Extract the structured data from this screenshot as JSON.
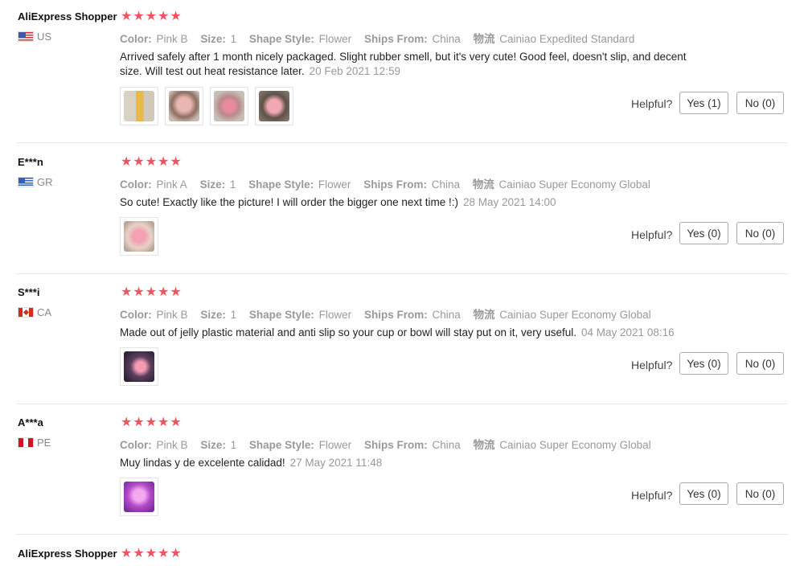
{
  "reviews": [
    {
      "user": "AliExpress Shopper",
      "country": "US",
      "stars": "★★★★★",
      "attrs": {
        "color_label": "Color:",
        "color": "Pink B",
        "size_label": "Size:",
        "size": "1",
        "shape_label": "Shape Style:",
        "shape": "Flower",
        "ships_label": "Ships From:",
        "ships": "China",
        "logistics_label": "物流",
        "logistics": "Cainiao Expedited Standard"
      },
      "text": "Arrived safely after 1 month nicely packaged. Slight rubber smell, but it's very cute! Good feel, doesn't slip, and decent size. Will test out heat resistance later.",
      "date": "20 Feb 2021 12:59",
      "helpful": "Helpful?",
      "yes": "Yes (1)",
      "no": "No (0)"
    },
    {
      "user": "E***n",
      "country": "GR",
      "stars": "★★★★★",
      "attrs": {
        "color_label": "Color:",
        "color": "Pink A",
        "size_label": "Size:",
        "size": "1",
        "shape_label": "Shape Style:",
        "shape": "Flower",
        "ships_label": "Ships From:",
        "ships": "China",
        "logistics_label": "物流",
        "logistics": "Cainiao Super Economy Global"
      },
      "text": "So cute! Exactly like the picture! I will order the bigger one next time !:)",
      "date": "28 May 2021 14:00",
      "helpful": "Helpful?",
      "yes": "Yes (0)",
      "no": "No (0)"
    },
    {
      "user": "S***i",
      "country": "CA",
      "stars": "★★★★★",
      "attrs": {
        "color_label": "Color:",
        "color": "Pink B",
        "size_label": "Size:",
        "size": "1",
        "shape_label": "Shape Style:",
        "shape": "Flower",
        "ships_label": "Ships From:",
        "ships": "China",
        "logistics_label": "物流",
        "logistics": "Cainiao Super Economy Global"
      },
      "text": "Made out of jelly plastic material and anti slip so your cup or bowl will stay put on it, very useful.",
      "date": "04 May 2021 08:16",
      "helpful": "Helpful?",
      "yes": "Yes (0)",
      "no": "No (0)"
    },
    {
      "user": "A***a",
      "country": "PE",
      "stars": "★★★★★",
      "attrs": {
        "color_label": "Color:",
        "color": "Pink B",
        "size_label": "Size:",
        "size": "1",
        "shape_label": "Shape Style:",
        "shape": "Flower",
        "ships_label": "Ships From:",
        "ships": "China",
        "logistics_label": "物流",
        "logistics": "Cainiao Super Economy Global"
      },
      "text": "Muy lindas y de excelente calidad!",
      "date": "27 May 2021 11:48",
      "helpful": "Helpful?",
      "yes": "Yes (0)",
      "no": "No (0)"
    },
    {
      "user": "AliExpress Shopper",
      "stars": "★★★★★"
    }
  ],
  "colors": {
    "star": "#f0555f",
    "muted": "#999999",
    "border": "#aaaaaa"
  }
}
